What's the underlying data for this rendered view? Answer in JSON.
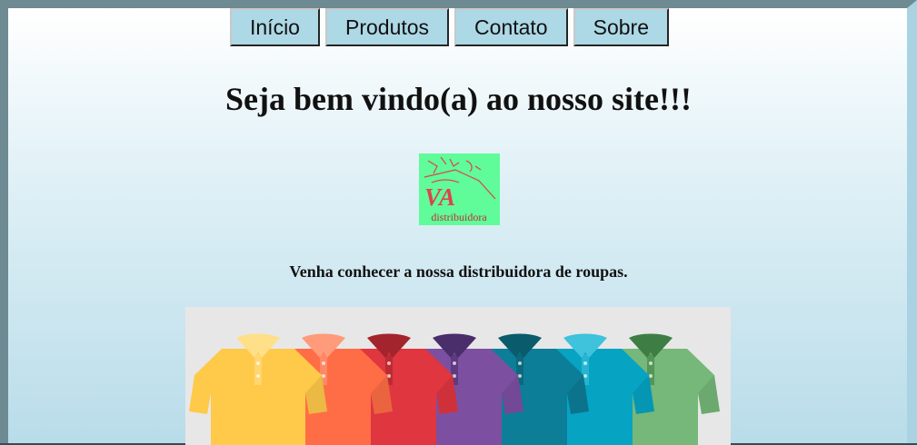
{
  "nav": {
    "items": [
      "Início",
      "Produtos",
      "Contato",
      "Sobre"
    ]
  },
  "page": {
    "heading": "Seja bem vindo(a) ao nosso site!!!",
    "tagline": "Venha conhecer a nossa distribuidora de roupas."
  },
  "logo": {
    "letters": "VA",
    "word": "distribuidora",
    "background": "#5ffc99",
    "color": "#e0414f"
  },
  "shirts": {
    "colors": [
      "#ffc94a",
      "#ff6d46",
      "#e0363f",
      "#7d4fa1",
      "#0d7e98",
      "#06a3c3",
      "#76b879"
    ],
    "collar_colors": [
      "#ffdf88",
      "#ff9b7a",
      "#a3242c",
      "#4a2d6b",
      "#0a5b6c",
      "#3fc2db",
      "#3e7e44"
    ]
  },
  "colors": {
    "nav_button": "#add8e6",
    "frame_dark": "#6e8a92",
    "frame_light": "#a9d3e2"
  }
}
